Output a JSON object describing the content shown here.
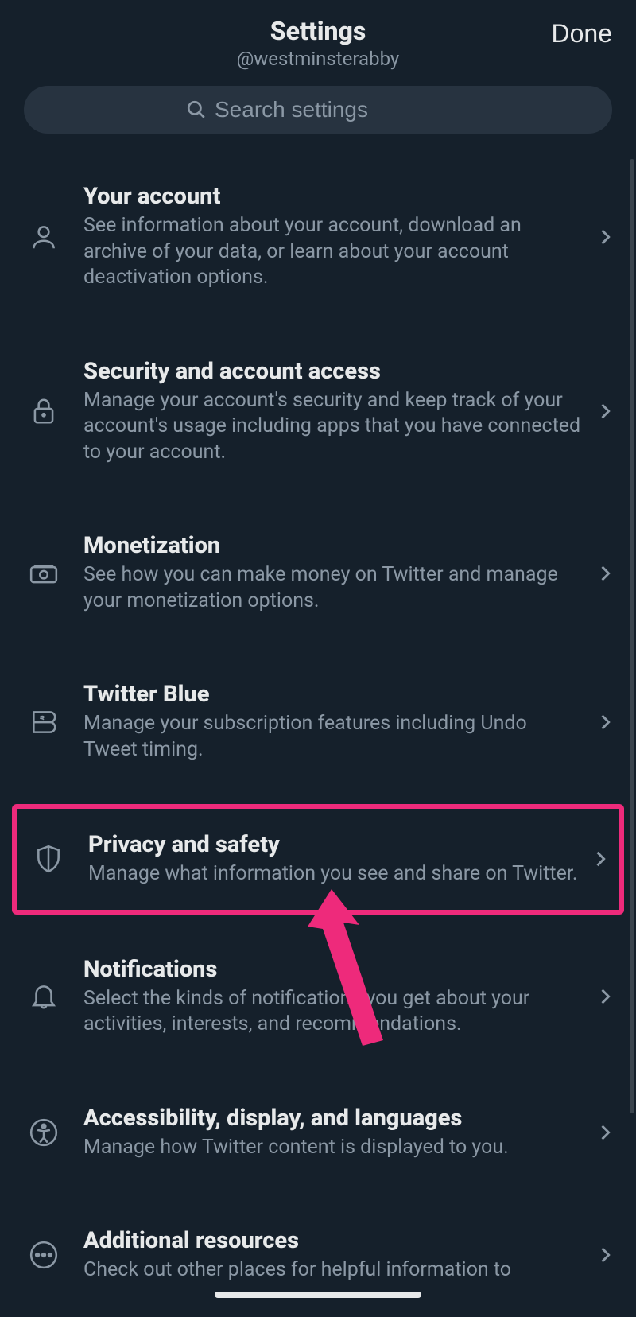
{
  "header": {
    "title": "Settings",
    "handle": "@westminsterabby",
    "done": "Done"
  },
  "search": {
    "placeholder": "Search settings"
  },
  "items": [
    {
      "icon": "person",
      "title": "Your account",
      "desc": "See information about your account, download an archive of your data, or learn about your account deactivation options.",
      "highlight": false
    },
    {
      "icon": "lock",
      "title": "Security and account access",
      "desc": "Manage your account's security and keep track of your account's usage including apps that you have connected to your account.",
      "highlight": false
    },
    {
      "icon": "money",
      "title": "Monetization",
      "desc": "See how you can make money on Twitter and manage your monetization options.",
      "highlight": false
    },
    {
      "icon": "twitter-blue",
      "title": "Twitter Blue",
      "desc": "Manage your subscription features including Undo Tweet timing.",
      "highlight": false
    },
    {
      "icon": "shield",
      "title": "Privacy and safety",
      "desc": "Manage what information you see and share on Twitter.",
      "highlight": true
    },
    {
      "icon": "bell",
      "title": "Notifications",
      "desc": "Select the kinds of notifications you get about your activities, interests, and recommendations.",
      "highlight": false
    },
    {
      "icon": "accessibility",
      "title": "Accessibility, display, and languages",
      "desc": "Manage how Twitter content is displayed to you.",
      "highlight": false
    },
    {
      "icon": "more",
      "title": "Additional resources",
      "desc": "Check out other places for helpful information to",
      "highlight": false
    }
  ]
}
